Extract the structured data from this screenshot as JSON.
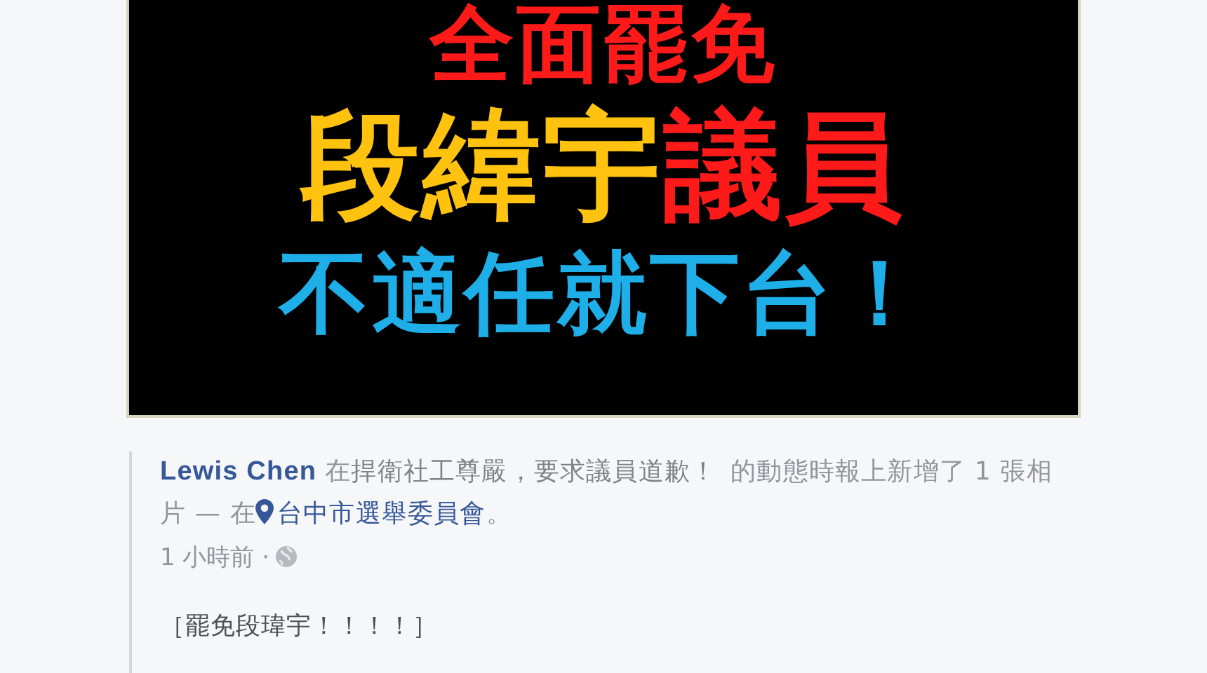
{
  "banner": {
    "lines": [
      [
        {
          "text": "全面罷免",
          "color": "#ff1a1a"
        }
      ],
      [
        {
          "text": "段緯宇",
          "color": "#ffc20e"
        },
        {
          "text": "議員",
          "color": "#ff1a1a"
        }
      ],
      [
        {
          "text": "不適任就下台！",
          "color": "#1eaee8"
        }
      ]
    ]
  },
  "story": {
    "parts": [
      {
        "kind": "author",
        "text": "Lewis Chen"
      },
      {
        "kind": "text",
        "text": "在"
      },
      {
        "kind": "page",
        "text": "捍衛社工尊嚴，要求議員道歉！"
      },
      {
        "kind": "text",
        "text": "的動態時報上新增了 1 張相片 — 在"
      },
      {
        "kind": "place",
        "text": "台中市選舉委員會"
      },
      {
        "kind": "text",
        "text": "。"
      }
    ],
    "timestamp": "1 小時前 ·",
    "message": "［罷免段瑋宇！！！！］"
  }
}
